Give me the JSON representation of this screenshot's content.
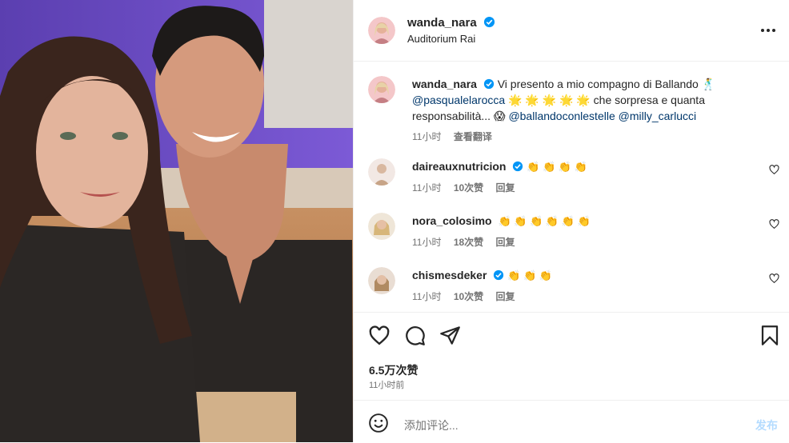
{
  "header": {
    "username": "wanda_nara",
    "location": "Auditorium Rai"
  },
  "caption": {
    "username": "wanda_nara",
    "text_1": "Vi presento a mio compagno di Ballando 🕺",
    "mention_1": "@pasqualelarocca",
    "text_2": "🌟 🌟 🌟 🌟 🌟 che sorpresa e quanta",
    "text_3": "responsabilità... 😱",
    "mention_2": "@ballandoconlestelle",
    "mention_3": "@milly_carlucci",
    "time": "11小时",
    "translate": "查看翻译"
  },
  "comments": [
    {
      "username": "daireauxnutricion",
      "verified": true,
      "text": "👏 👏 👏 👏",
      "time": "11小时",
      "likes": "10次赞",
      "reply": "回复"
    },
    {
      "username": "nora_colosimo",
      "verified": false,
      "text": "👏 👏 👏 👏 👏 👏",
      "time": "11小时",
      "likes": "18次赞",
      "reply": "回复"
    },
    {
      "username": "chismesdeker",
      "verified": true,
      "text": "👏 👏 👏",
      "time": "11小时",
      "likes": "10次赞",
      "reply": "回复"
    }
  ],
  "actions": {
    "likes": "6.5万次赞",
    "time": "11小时前"
  },
  "add_comment": {
    "placeholder": "添加评论...",
    "post": "发布"
  },
  "colors": {
    "verified": "#0095f6",
    "link": "#00376b",
    "muted": "#737373"
  }
}
